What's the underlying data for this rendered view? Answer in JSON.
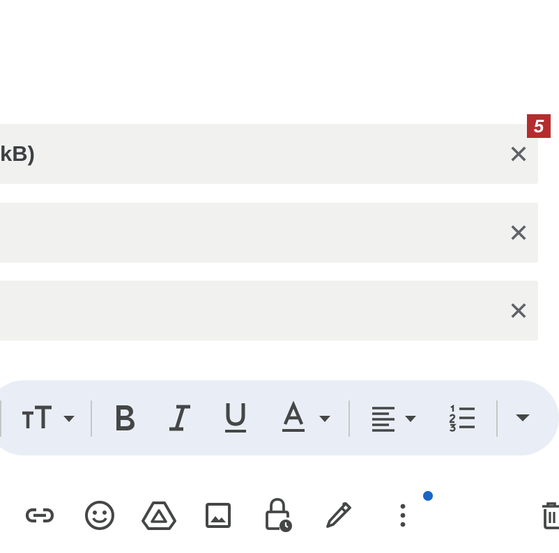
{
  "attachments": [
    {
      "text": "kB)"
    },
    {
      "text": ""
    },
    {
      "text": ""
    }
  ],
  "badge": {
    "label": "5"
  },
  "formatting_toolbar": {
    "items": [
      "text-size-icon",
      "bold-icon",
      "italic-icon",
      "underline-icon",
      "text-color-icon",
      "align-icon",
      "numbered-list-icon",
      "more-formatting-icon"
    ]
  },
  "bottom_toolbar": {
    "items": [
      "insert-link-icon",
      "emoji-icon",
      "drive-icon",
      "insert-photo-icon",
      "confidential-mode-icon",
      "signature-icon",
      "more-options-icon",
      "discard-icon"
    ],
    "notification_dot_color": "#1a66c8"
  },
  "colors": {
    "attachment_bg": "#f1f1f0",
    "toolbar_bg": "#e9eef6",
    "badge_bg": "#b62c2e",
    "icon": "#444746"
  }
}
